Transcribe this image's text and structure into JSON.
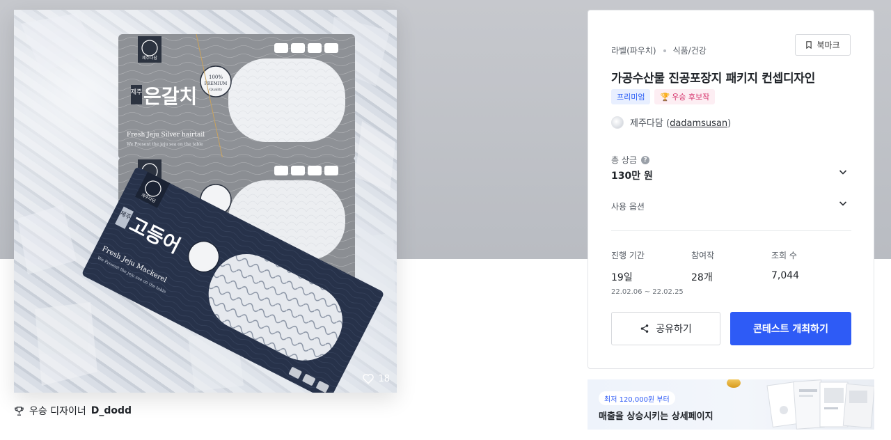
{
  "hero": {
    "alt": "가공수산물 진공포장지 패키지 컨셉디자인",
    "like_count": "18",
    "pack_top": {
      "brand": "제주다담",
      "product_small": "제주",
      "product_name": "은갈치",
      "english": "Fresh Jeju Silver hairtail",
      "tagline": "We Present the jeju sea on the table",
      "seal_line1": "100%",
      "seal_line2": "PREMIUM",
      "seal_line3": "Quality"
    },
    "pack_bottom": {
      "brand": "제주다담",
      "product_small": "제주",
      "product_name": "고등어",
      "english": "Fresh Jeju Mackerel",
      "tagline": "We Present the jeju sea on the table"
    }
  },
  "winner": {
    "label": "우승 디자이너",
    "name": "D_dodd"
  },
  "card": {
    "category": "라벨(파우치)",
    "subcategory": "식품/건강",
    "bookmark_label": "북마크",
    "title": "가공수산물 진공포장지 패키지 컨셉디자인",
    "badges": {
      "premium": "프리미엄",
      "winner_candidate": "우승 후보작"
    },
    "owner_name": "제주다담",
    "owner_id": "dadamsusan",
    "prize_label": "총 상금",
    "prize_value": "130만 원",
    "options_label": "사용 옵션",
    "stats": {
      "duration_label": "진행 기간",
      "duration_value": "19일",
      "duration_range": "22.02.06 ~ 22.02.25",
      "entries_label": "참여작",
      "entries_value": "28개",
      "views_label": "조회 수",
      "views_value": "7,044"
    },
    "share_label": "공유하기",
    "host_label": "콘테스트 개최하기",
    "accent_color": "#2e5bf6"
  },
  "ad": {
    "pill": "최저 120,000원 부터",
    "text": "매출을 상승시키는 상세페이지"
  },
  "icons": [
    "heart-icon",
    "trophy-icon",
    "bookmark-icon",
    "help-icon",
    "chevron-down-icon",
    "share-icon"
  ]
}
